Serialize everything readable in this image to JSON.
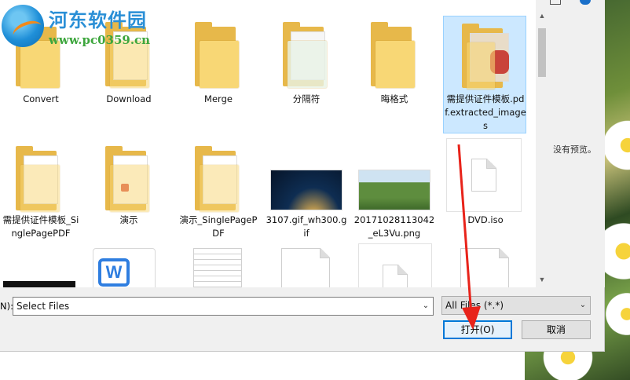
{
  "watermark": {
    "name": "河东软件园",
    "url": "www.pc0359.cn"
  },
  "files": [
    {
      "label": "Convert",
      "kind": "folder"
    },
    {
      "label": "Download",
      "kind": "folder"
    },
    {
      "label": "Merge",
      "kind": "folder"
    },
    {
      "label": "分隔符",
      "kind": "folder"
    },
    {
      "label": "晦格式",
      "kind": "folder"
    },
    {
      "label": "需提供证件模板.pdf.extracted_images",
      "kind": "folder",
      "selected": true
    },
    {
      "label": "需提供证件模板_SinglePagePDF",
      "kind": "folder"
    },
    {
      "label": "演示",
      "kind": "folder"
    },
    {
      "label": "演示_SinglePagePDF",
      "kind": "folder"
    },
    {
      "label": "3107.gif_wh300.gif",
      "kind": "image"
    },
    {
      "label": "20171028113042_eL3Vu.png",
      "kind": "image"
    },
    {
      "label": "DVD.iso",
      "kind": "file"
    }
  ],
  "preview": {
    "empty_text": "没有预览。"
  },
  "bottom": {
    "filename_label": "N):",
    "filename_value": "Select Files",
    "filter_value": "All Files (*.*)",
    "open_label": "打开(O)",
    "cancel_label": "取消"
  }
}
